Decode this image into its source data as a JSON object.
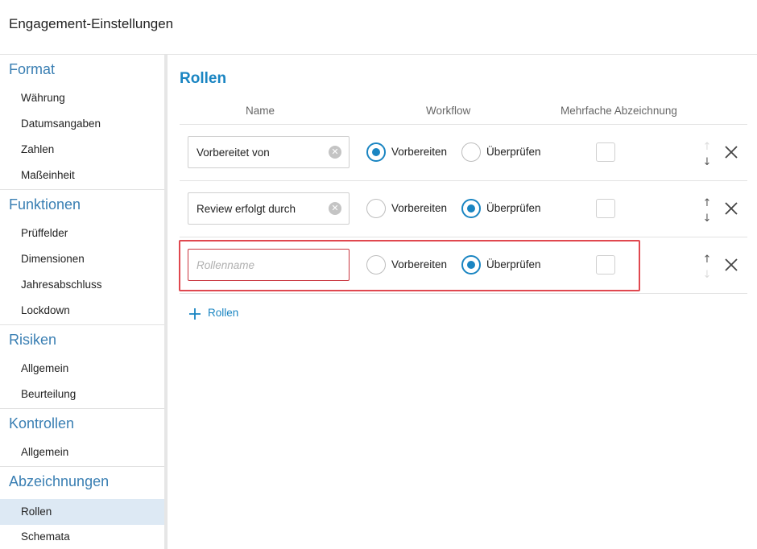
{
  "header": {
    "title": "Engagement-Einstellungen"
  },
  "sidebar": {
    "sections": [
      {
        "title": "Format",
        "items": [
          "Währung",
          "Datumsangaben",
          "Zahlen",
          "Maßeinheit"
        ]
      },
      {
        "title": "Funktionen",
        "items": [
          "Prüffelder",
          "Dimensionen",
          "Jahresabschluss",
          "Lockdown"
        ]
      },
      {
        "title": "Risiken",
        "items": [
          "Allgemein",
          "Beurteilung"
        ]
      },
      {
        "title": "Kontrollen",
        "items": [
          "Allgemein"
        ]
      },
      {
        "title": "Abzeichnungen",
        "items": [
          "Rollen",
          "Schemata"
        ]
      }
    ],
    "active_item": "Rollen"
  },
  "main": {
    "title": "Rollen",
    "columns": {
      "name": "Name",
      "workflow": "Workflow",
      "multi": "Mehrfache Abzeichnung"
    },
    "workflow_options": {
      "prepare": "Vorbereiten",
      "review": "Überprüfen"
    },
    "rows": [
      {
        "name": "Vorbereitet von",
        "placeholder": "",
        "workflow": "Vorbereiten",
        "multi": false,
        "can_move_up": false,
        "can_move_down": true
      },
      {
        "name": "Review erfolgt durch",
        "placeholder": "",
        "workflow": "Überprüfen",
        "multi": false,
        "can_move_up": true,
        "can_move_down": true
      },
      {
        "name": "",
        "placeholder": "Rollenname",
        "workflow": "Überprüfen",
        "multi": false,
        "can_move_up": true,
        "can_move_down": false,
        "error": true
      }
    ],
    "add_label": "Rollen"
  },
  "colors": {
    "accent": "#1a85c2",
    "section": "#3a7fb3",
    "error": "#c9363f",
    "highlight": "#e0484f",
    "active_bg": "#dde9f4"
  }
}
